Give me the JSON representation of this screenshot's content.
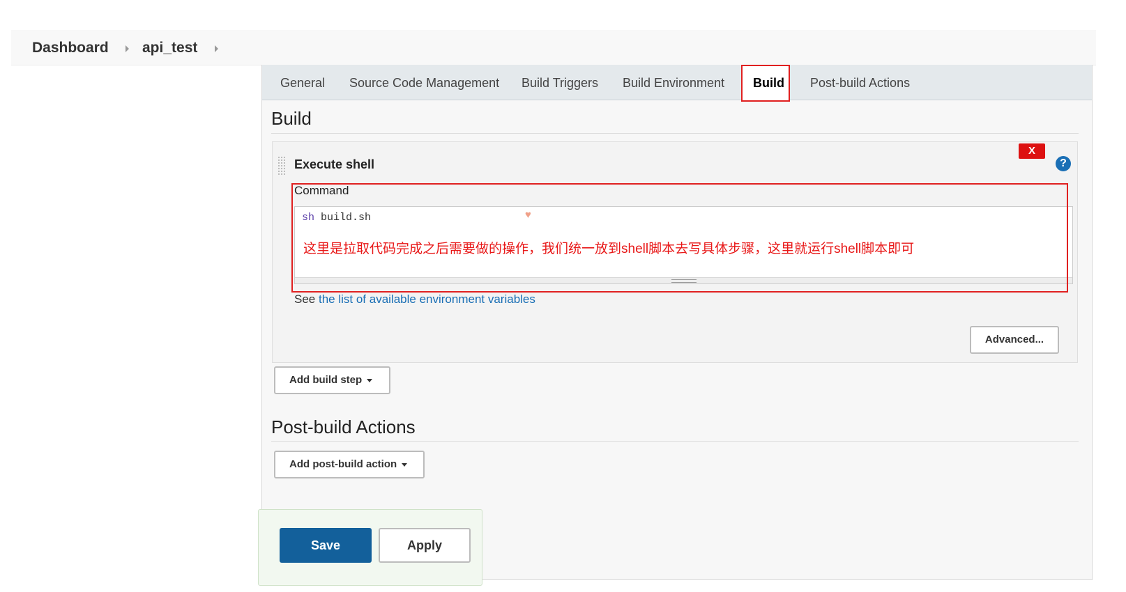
{
  "breadcrumb": {
    "items": [
      "Dashboard",
      "api_test"
    ]
  },
  "tabs": [
    {
      "label": "General"
    },
    {
      "label": "Source Code Management"
    },
    {
      "label": "Build Triggers"
    },
    {
      "label": "Build Environment"
    },
    {
      "label": "Build",
      "active": true
    },
    {
      "label": "Post-build Actions"
    }
  ],
  "build_section": {
    "title": "Build",
    "step": {
      "title": "Execute shell",
      "delete_label": "X",
      "help_label": "?",
      "command_label": "Command",
      "command_keyword": "sh",
      "command_rest": " build.sh",
      "annotation": "这里是拉取代码完成之后需要做的操作，我们统一放到shell脚本去写具体步骤，这里就运行shell脚本即可",
      "env_prefix": "See ",
      "env_link": "the list of available environment variables",
      "advanced_label": "Advanced..."
    },
    "add_step_label": "Add build step"
  },
  "post_build_section": {
    "title": "Post-build Actions",
    "add_action_label": "Add post-build action"
  },
  "footer": {
    "save_label": "Save",
    "apply_label": "Apply"
  },
  "colors": {
    "primary": "#13609b",
    "annotation_red": "#e81818",
    "link": "#1a6fb5",
    "delete": "#dd1111"
  }
}
